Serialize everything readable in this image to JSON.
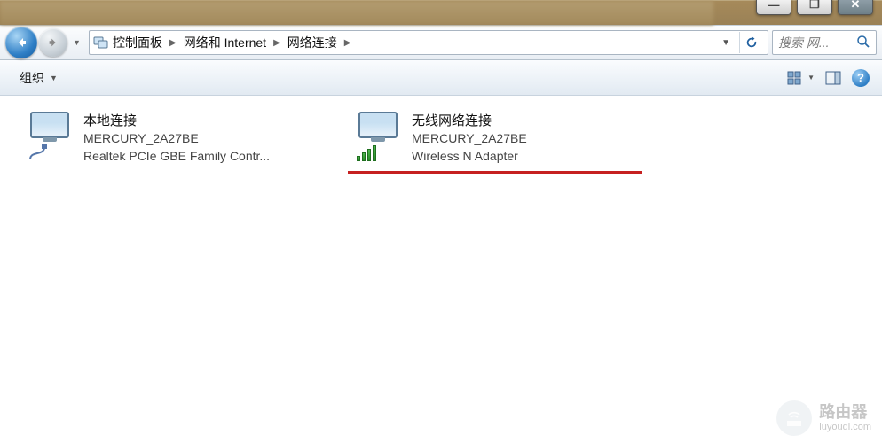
{
  "window": {
    "minimize": "—",
    "maximize": "❐",
    "close": "✕"
  },
  "nav": {
    "breadcrumbs": [
      "控制面板",
      "网络和 Internet",
      "网络连接"
    ],
    "search_placeholder": "搜索 网..."
  },
  "toolbar": {
    "organize": "组织"
  },
  "connections": [
    {
      "title": "本地连接",
      "network": "MERCURY_2A27BE",
      "adapter": "Realtek PCIe GBE Family Contr...",
      "type": "ethernet",
      "highlighted": false
    },
    {
      "title": "无线网络连接",
      "network": "MERCURY_2A27BE",
      "adapter": "Wireless N Adapter",
      "type": "wifi",
      "highlighted": true
    }
  ],
  "watermark": {
    "cn": "路由器",
    "en": "luyouqi.com"
  }
}
